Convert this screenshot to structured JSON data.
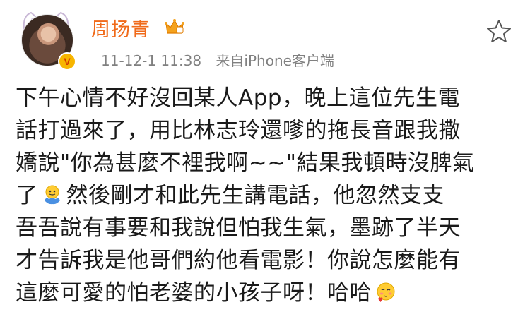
{
  "user": {
    "name": "周扬青",
    "badge": "V"
  },
  "meta": {
    "timestamp": "11-12-1 11:38",
    "source": "来自iPhone客户端"
  },
  "post": {
    "lines": [
      "下午心情不好沒回某人App，晚上這位先生電",
      "話打過來了，用比林志玲還嗲的拖長音跟我撒",
      "嬌說\"你為甚麼不裡我啊~~\"結果我頓時沒脾氣",
      "了",
      "然後剛才和此先生講電話，他忽然支支",
      "吾吾說有事要和我說但怕我生氣，墨跡了半天",
      "才告訴我是他哥們約他看電影！你說怎麼能有",
      "這麼可愛的怕老婆的小孩子呀！哈哈"
    ]
  },
  "icons": {
    "star": "star-outline-icon",
    "crown": "crown-icon",
    "shrug": "shrug-emoji-icon",
    "blush": "blush-emoji-icon"
  },
  "colors": {
    "username": "#f06a1a",
    "meta": "#808080",
    "text": "#1a1a1a",
    "badge": "#f7b500"
  }
}
